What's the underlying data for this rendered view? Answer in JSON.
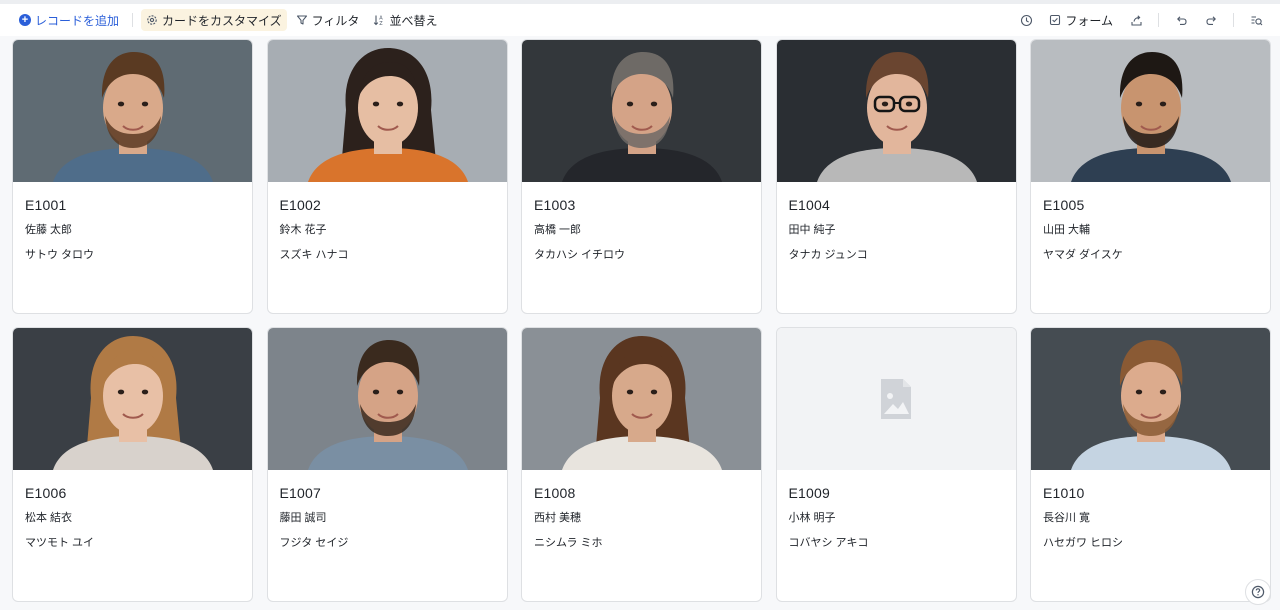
{
  "toolbar": {
    "add_record": "レコードを追加",
    "customize_card": "カードをカスタマイズ",
    "filter": "フィルタ",
    "sort": "並べ替え",
    "form": "フォーム",
    "icons": [
      "history-icon",
      "form-icon",
      "share-icon",
      "undo-icon",
      "redo-icon",
      "search-icon"
    ]
  },
  "colors": {
    "accent": "#2b5fd9",
    "active_bg": "#fbf3e0",
    "card_border": "#dee0e3"
  },
  "cards": [
    {
      "id": "E1001",
      "name": "佐藤 太郎",
      "kana": "サトウ タロウ",
      "photo": {
        "bg": "#5f6b73",
        "skin": "#d9a98a",
        "hair": "#5a3a22",
        "shirt": "#4f6d8a",
        "beard": true,
        "long": false,
        "glasses": false
      }
    },
    {
      "id": "E1002",
      "name": "鈴木 花子",
      "kana": "スズキ ハナコ",
      "photo": {
        "bg": "#a7adb3",
        "skin": "#e6bea3",
        "hair": "#2c211c",
        "shirt": "#d9742c",
        "beard": false,
        "long": true,
        "glasses": false
      }
    },
    {
      "id": "E1003",
      "name": "高橋 一郎",
      "kana": "タカハシ イチロウ",
      "photo": {
        "bg": "#33373b",
        "skin": "#d4a387",
        "hair": "#6e6a66",
        "shirt": "#24262b",
        "beard": true,
        "long": false,
        "glasses": false
      }
    },
    {
      "id": "E1004",
      "name": "田中 純子",
      "kana": "タナカ ジュンコ",
      "photo": {
        "bg": "#2a2e33",
        "skin": "#e2b69c",
        "hair": "#6a4530",
        "shirt": "#b8b8b8",
        "beard": false,
        "long": false,
        "glasses": true
      }
    },
    {
      "id": "E1005",
      "name": "山田 大輔",
      "kana": "ヤマダ ダイスケ",
      "photo": {
        "bg": "#b8bcc0",
        "skin": "#c8946f",
        "hair": "#1e1814",
        "shirt": "#2e3f52",
        "beard": true,
        "long": false,
        "glasses": false
      }
    },
    {
      "id": "E1006",
      "name": "松本 結衣",
      "kana": "マツモト ユイ",
      "photo": {
        "bg": "#3a3f45",
        "skin": "#e8c0a6",
        "hair": "#b07a45",
        "shirt": "#d8d2cc",
        "beard": false,
        "long": true,
        "glasses": false
      }
    },
    {
      "id": "E1007",
      "name": "藤田 誠司",
      "kana": "フジタ セイジ",
      "photo": {
        "bg": "#7d848b",
        "skin": "#d5a386",
        "hair": "#3a2a1e",
        "shirt": "#7a8fa3",
        "beard": true,
        "long": false,
        "glasses": false
      }
    },
    {
      "id": "E1008",
      "name": "西村 美穂",
      "kana": "ニシムラ ミホ",
      "photo": {
        "bg": "#8a9096",
        "skin": "#d7a98b",
        "hair": "#5a3620",
        "shirt": "#e8e4de",
        "beard": false,
        "long": true,
        "glasses": false
      }
    },
    {
      "id": "E1009",
      "name": "小林 明子",
      "kana": "コバヤシ アキコ",
      "photo": null
    },
    {
      "id": "E1010",
      "name": "長谷川 寛",
      "kana": "ハセガワ ヒロシ",
      "photo": {
        "bg": "#454c52",
        "skin": "#dcab8d",
        "hair": "#8a5a34",
        "shirt": "#c5d4e2",
        "beard": true,
        "long": false,
        "glasses": false
      }
    }
  ]
}
